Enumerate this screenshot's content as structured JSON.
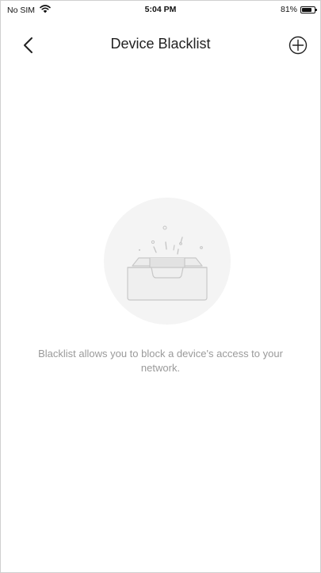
{
  "status_bar": {
    "carrier": "No SIM",
    "time": "5:04 PM",
    "battery": "81%",
    "battery_level": 0.81
  },
  "nav": {
    "title": "Device Blacklist",
    "back_icon": "chevron-left-icon",
    "add_icon": "plus-circle-icon"
  },
  "empty_state": {
    "message": "Blacklist allows you to block a device's access to your network.",
    "illustration_icon": "empty-box-icon"
  },
  "colors": {
    "background": "#ffffff",
    "text": "#222222",
    "muted_text": "#9a9a9a",
    "illustration_bg": "#f4f4f4"
  }
}
